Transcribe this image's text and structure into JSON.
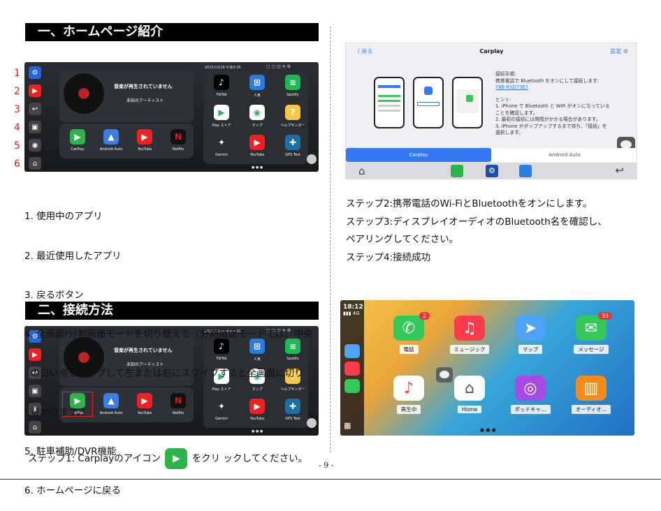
{
  "section1": {
    "title": "一、ホームページ紹介"
  },
  "section2": {
    "title": "二、接続方法"
  },
  "side_numbers": [
    "1",
    "2",
    "3",
    "4",
    "5",
    "6"
  ],
  "head_unit": {
    "date": "2025/10/28 午後9:36",
    "now_playing": "音楽が再生されていません",
    "artist": "未知のアーティスト",
    "dock": [
      {
        "label": "CarPlay",
        "icon": "carplay-icon",
        "color": "#2db34a"
      },
      {
        "label": "Android Auto",
        "icon": "android-auto-icon",
        "color": "#3c7ee0"
      },
      {
        "label": "YouTube",
        "icon": "youtube-icon",
        "color": "#e22"
      },
      {
        "label": "Netflix",
        "icon": "netflix-icon",
        "color": "#111"
      }
    ],
    "grid": [
      {
        "label": "TikTok",
        "icon": "tiktok-icon",
        "color": "#000",
        "glyph": "♪"
      },
      {
        "label": "人気",
        "icon": "popular-icon",
        "color": "#2a7de1",
        "glyph": "⊞"
      },
      {
        "label": "Spotify",
        "icon": "spotify-icon",
        "color": "#1db954",
        "glyph": "≋"
      },
      {
        "label": "Play ストア",
        "icon": "play-store-icon",
        "color": "#fff",
        "glyph": "▶"
      },
      {
        "label": "マップ",
        "icon": "maps-icon",
        "color": "#fff",
        "glyph": "◉"
      },
      {
        "label": "ヘルプセンター",
        "icon": "help-center-icon",
        "color": "#f7c74a",
        "glyph": "?"
      },
      {
        "label": "Gemini",
        "icon": "gemini-icon",
        "color": "#2b2e33",
        "glyph": "✦"
      },
      {
        "label": "YouTube",
        "icon": "youtube-icon",
        "color": "#e22",
        "glyph": "▶"
      },
      {
        "label": "GPS Test",
        "icon": "gps-test-icon",
        "color": "#1b6ea8",
        "glyph": "✚"
      }
    ]
  },
  "features": [
    "1. 使用中のアプリ",
    "2. 最近使用したアプリ",
    "3. 戻るボタン",
    "4. 全画面/分割画面モードを切り替える（分割画面モードでは、中央",
    "  の白い点をタップして左または右にスワイプすると全画面に切り",
    "  替わります。）",
    "5. 駐車補助/DVR機能",
    "6. ホームページに戻る"
  ],
  "ios_screen": {
    "back": "〈 戻る",
    "title": "Carplay",
    "settings": "設定",
    "hint_lines": [
      "接続手順:",
      "携帯電話で Bluetooth をオンにして接続します:",
      "T88-RXD73E7",
      "",
      "ヒント:",
      "1. iPhone で Bluetooth と WiFi がオンになっている",
      "ことを確認します。",
      "2. 最初の接続には時間がかかる場合があります。",
      "3. iPhone がポップアップするまで待ち、「接続」を",
      "選択します。"
    ],
    "tab_active": "Carplay",
    "tab_inactive": "Android Auto"
  },
  "steps": [
    "ステップ2:携帯電話のWi-FiとBluetoothをオンにします。",
    "ステップ3:ディスプレイオーディオのBluetooth名を確認し、",
    "ペアリングしてください。",
    "ステップ4:接続成功"
  ],
  "carplay_screen": {
    "time": "18:12",
    "signal": "4G",
    "apps": [
      {
        "label": "電話",
        "icon": "phone-icon",
        "color": "#34c759",
        "glyph": "✆",
        "badge": "2"
      },
      {
        "label": "ミュージック",
        "icon": "music-icon",
        "color": "#fa3c4c",
        "glyph": "♫",
        "badge": ""
      },
      {
        "label": "マップ",
        "icon": "maps-icon",
        "color": "#4fa3f5",
        "glyph": "➤",
        "badge": ""
      },
      {
        "label": "メッセージ",
        "icon": "messages-icon",
        "color": "#34c759",
        "glyph": "✉",
        "badge": "33"
      },
      {
        "label": "再生中",
        "icon": "now-playing-icon",
        "color": "#fff",
        "glyph": "♪",
        "badge": ""
      },
      {
        "label": "Home",
        "icon": "home-icon",
        "color": "#fff",
        "glyph": "⌂",
        "badge": ""
      },
      {
        "label": "ポッドキャ…",
        "icon": "podcasts-icon",
        "color": "#a64be6",
        "glyph": "◎",
        "badge": ""
      },
      {
        "label": "オーディオ…",
        "icon": "audiobooks-icon",
        "color": "#f48b1d",
        "glyph": "▥",
        "badge": ""
      }
    ]
  },
  "step1": {
    "before": "ステップ1: Carplayのアイコン",
    "after": "をクリ ックしてください。"
  },
  "page_number": "- 9 -"
}
